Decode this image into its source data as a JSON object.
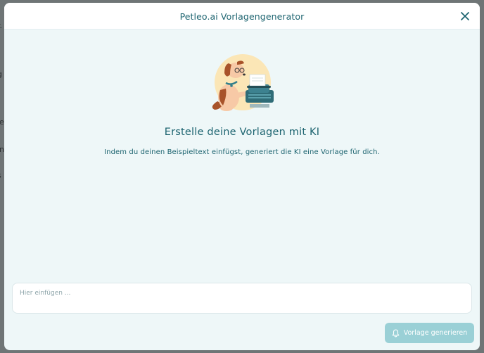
{
  "background": {
    "fragments": [
      "r.",
      "g",
      "le",
      "in",
      "s"
    ]
  },
  "modal": {
    "title": "Petleo.ai Vorlagengenerator",
    "close_icon": "close-icon",
    "illustration": "dog-typewriter-illustration",
    "heading": "Erstelle deine Vorlagen mit KI",
    "subtext": "Indem du deinen Beispieltext einfügst, generiert die KI eine Vorlage für dich.",
    "input": {
      "placeholder": "Hier einfügen ...",
      "value": ""
    },
    "generate_button": {
      "icon": "bell-icon",
      "label": "Vorlage generieren"
    }
  },
  "colors": {
    "accent": "#1d6470",
    "button": "#9ad0d6",
    "modal_bg": "#eef7f8"
  }
}
